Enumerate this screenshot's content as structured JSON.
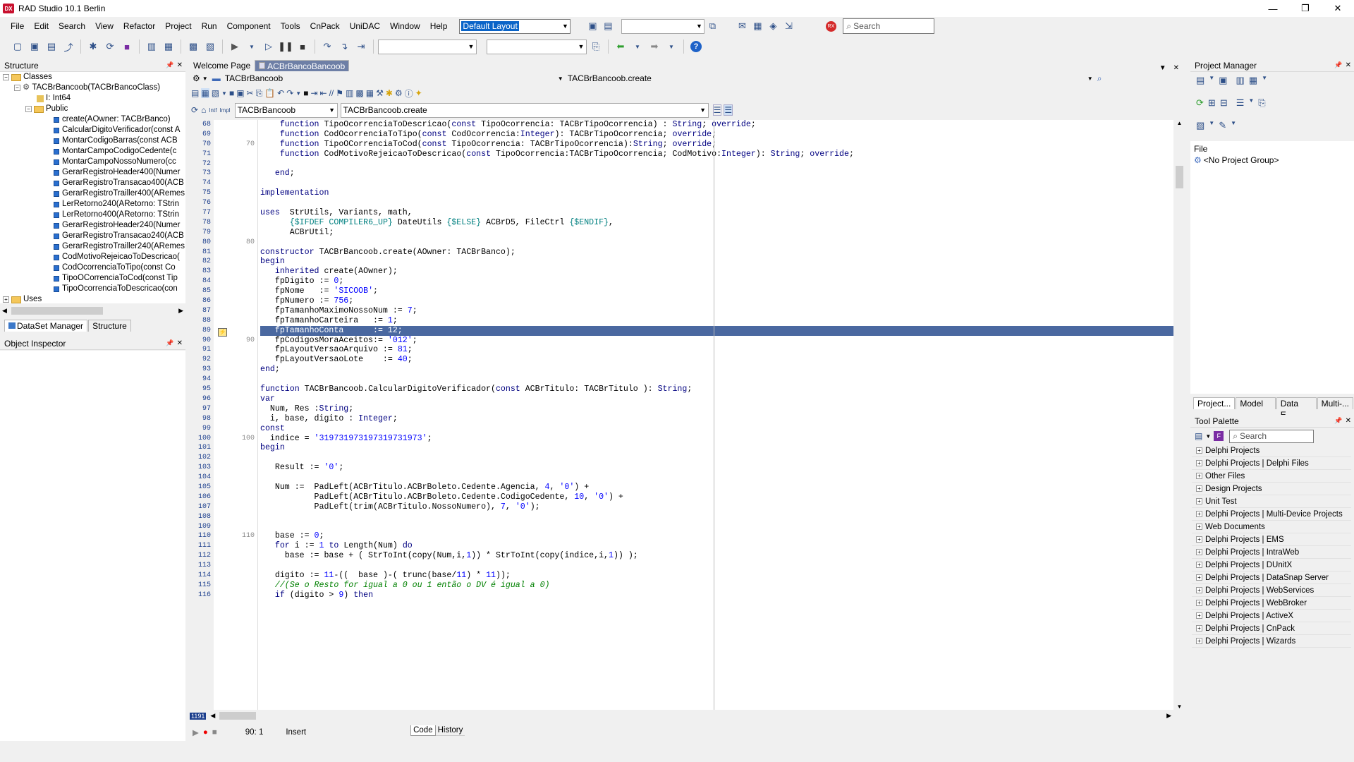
{
  "window": {
    "title": "RAD Studio 10.1 Berlin",
    "logo": "DX",
    "min": "—",
    "max": "❐",
    "close": "✕"
  },
  "menu": [
    "File",
    "Edit",
    "Search",
    "View",
    "Refactor",
    "Project",
    "Run",
    "Component",
    "Tools",
    "CnPack",
    "UniDAC",
    "Window",
    "Help"
  ],
  "layout_combo": "Default Layout",
  "search_placeholder": "Search",
  "structure": {
    "title": "Structure",
    "classes": "Classes",
    "class_node": "TACBrBancoob(TACBrBancoClass)",
    "field": "I: Int64",
    "public": "Public",
    "methods": [
      "create(AOwner: TACBrBanco)",
      "CalcularDigitoVerificador(const A",
      "MontarCodigoBarras(const ACB",
      "MontarCampoCodigoCedente(c",
      "MontarCampoNossoNumero(cc",
      "GerarRegistroHeader400(Numer",
      "GerarRegistroTransacao400(ACB",
      "GerarRegistroTrailler400(ARemes",
      "LerRetorno240(ARetorno: TStrin",
      "LerRetorno400(ARetorno: TStrin",
      "GerarRegistroHeader240(Numer",
      "GerarRegistroTransacao240(ACB",
      "GerarRegistroTrailler240(ARemes",
      "CodMotivoRejeicaoToDescricao(",
      "CodOcorrenciaToTipo(const Co",
      "TipoOCorrenciaToCod(const Tip",
      "TipoOcorrenciaToDescricao(con"
    ],
    "uses": "Uses",
    "tabs": [
      "DataSet Manager",
      "Structure"
    ]
  },
  "object_inspector": {
    "title": "Object Inspector"
  },
  "editor": {
    "tabs": [
      "Welcome Page",
      "ACBrBancoBancoob"
    ],
    "unit_combo": "TACBrBancoob",
    "method_combo": "TACBrBancoob.create",
    "class_combo": "TACBrBancoob",
    "proc_combo": "TACBrBancoob.create",
    "lines": [
      {
        "n": "68",
        "m": "",
        "t": "    function TipoOcorrenciaToDescricao(const TipoOcorrencia: TACBrTipoOcorrencia) : String; override;"
      },
      {
        "n": "69",
        "m": "",
        "t": "    function CodOcorrenciaToTipo(const CodOcorrencia:Integer): TACBrTipoOcorrencia; override;"
      },
      {
        "n": "70",
        "m": "70",
        "t": "    function TipoOCorrenciaToCod(const TipoOcorrencia: TACBrTipoOcorrencia):String; override;"
      },
      {
        "n": "71",
        "m": "",
        "t": "    function CodMotivoRejeicaoToDescricao(const TipoOcorrencia:TACBrTipoOcorrencia; CodMotivo:Integer): String; override;"
      },
      {
        "n": "72",
        "m": "",
        "t": ""
      },
      {
        "n": "73",
        "m": "",
        "t": "   end;"
      },
      {
        "n": "74",
        "m": "",
        "t": ""
      },
      {
        "n": "75",
        "m": "",
        "t": "implementation"
      },
      {
        "n": "76",
        "m": "",
        "t": ""
      },
      {
        "n": "77",
        "m": "",
        "t": "uses  StrUtils, Variants, math,"
      },
      {
        "n": "78",
        "m": "",
        "t": "      {$IFDEF COMPILER6_UP} DateUtils {$ELSE} ACBrD5, FileCtrl {$ENDIF},"
      },
      {
        "n": "79",
        "m": "",
        "t": "      ACBrUtil;"
      },
      {
        "n": "80",
        "m": "80",
        "t": ""
      },
      {
        "n": "81",
        "m": "",
        "t": "constructor TACBrBancoob.create(AOwner: TACBrBanco);"
      },
      {
        "n": "82",
        "m": "",
        "t": "begin"
      },
      {
        "n": "83",
        "m": "",
        "t": "   inherited create(AOwner);"
      },
      {
        "n": "84",
        "m": "",
        "t": "   fpDigito := 0;"
      },
      {
        "n": "85",
        "m": "",
        "t": "   fpNome   := 'SICOOB';"
      },
      {
        "n": "86",
        "m": "",
        "t": "   fpNumero := 756;"
      },
      {
        "n": "87",
        "m": "",
        "t": "   fpTamanhoMaximoNossoNum := 7;"
      },
      {
        "n": "88",
        "m": "",
        "t": "   fpTamanhoCarteira   := 1;"
      },
      {
        "n": "89",
        "m": "",
        "t": "   fpTamanhoConta      := 12;"
      },
      {
        "n": "90",
        "m": "90",
        "t": "   fpCodigosMoraAceitos:= '012';"
      },
      {
        "n": "91",
        "m": "",
        "t": "   fpLayoutVersaoArquivo := 81;"
      },
      {
        "n": "92",
        "m": "",
        "t": "   fpLayoutVersaoLote    := 40;"
      },
      {
        "n": "93",
        "m": "",
        "t": "end;"
      },
      {
        "n": "94",
        "m": "",
        "t": ""
      },
      {
        "n": "95",
        "m": "",
        "t": "function TACBrBancoob.CalcularDigitoVerificador(const ACBrTitulo: TACBrTitulo ): String;"
      },
      {
        "n": "96",
        "m": "",
        "t": "var"
      },
      {
        "n": "97",
        "m": "",
        "t": "  Num, Res :String;"
      },
      {
        "n": "98",
        "m": "",
        "t": "  i, base, digito : Integer;"
      },
      {
        "n": "99",
        "m": "",
        "t": "const"
      },
      {
        "n": "100",
        "m": "100",
        "t": "  indice = '319731973197319731973';"
      },
      {
        "n": "101",
        "m": "",
        "t": "begin"
      },
      {
        "n": "102",
        "m": "",
        "t": ""
      },
      {
        "n": "103",
        "m": "",
        "t": "   Result := '0';"
      },
      {
        "n": "104",
        "m": "",
        "t": ""
      },
      {
        "n": "105",
        "m": "",
        "t": "   Num :=  PadLeft(ACBrTitulo.ACBrBoleto.Cedente.Agencia, 4, '0') +"
      },
      {
        "n": "106",
        "m": "",
        "t": "           PadLeft(ACBrTitulo.ACBrBoleto.Cedente.CodigoCedente, 10, '0') +"
      },
      {
        "n": "107",
        "m": "",
        "t": "           PadLeft(trim(ACBrTitulo.NossoNumero), 7, '0');"
      },
      {
        "n": "108",
        "m": "",
        "t": ""
      },
      {
        "n": "109",
        "m": "",
        "t": ""
      },
      {
        "n": "110",
        "m": "110",
        "t": "   base := 0;"
      },
      {
        "n": "111",
        "m": "",
        "t": "   for i := 1 to Length(Num) do"
      },
      {
        "n": "112",
        "m": "",
        "t": "     base := base + ( StrToInt(copy(Num,i,1)) * StrToInt(copy(indice,i,1)) );"
      },
      {
        "n": "113",
        "m": "",
        "t": ""
      },
      {
        "n": "114",
        "m": "",
        "t": "   digito := 11-((  base )-( trunc(base/11) * 11));"
      },
      {
        "n": "115",
        "m": "",
        "t": "   //(Se o Resto for igual a 0 ou 1 então o DV é igual a 0)"
      },
      {
        "n": "116",
        "m": "",
        "t": "   if (digito > 9) then"
      }
    ],
    "highlight_line": "89",
    "status_pos": "90: 1",
    "status_mode": "Insert",
    "bottom_tabs": [
      "Code",
      "History"
    ],
    "corner_badge": "1191"
  },
  "project_manager": {
    "title": "Project Manager",
    "file_label": "File",
    "group": "<No Project Group>",
    "tabs": [
      "Project...",
      "Model ...",
      "Data E...",
      "Multi-..."
    ]
  },
  "tool_palette": {
    "title": "Tool Palette",
    "search": "Search",
    "items": [
      "Delphi Projects",
      "Delphi Projects | Delphi Files",
      "Other Files",
      "Design Projects",
      "Unit Test",
      "Delphi Projects | Multi-Device Projects",
      "Web Documents",
      "Delphi Projects | EMS",
      "Delphi Projects | IntraWeb",
      "Delphi Projects | DUnitX",
      "Delphi Projects | DataSnap Server",
      "Delphi Projects | WebServices",
      "Delphi Projects | WebBroker",
      "Delphi Projects | ActiveX",
      "Delphi Projects | CnPack",
      "Delphi Projects | Wizards"
    ]
  }
}
